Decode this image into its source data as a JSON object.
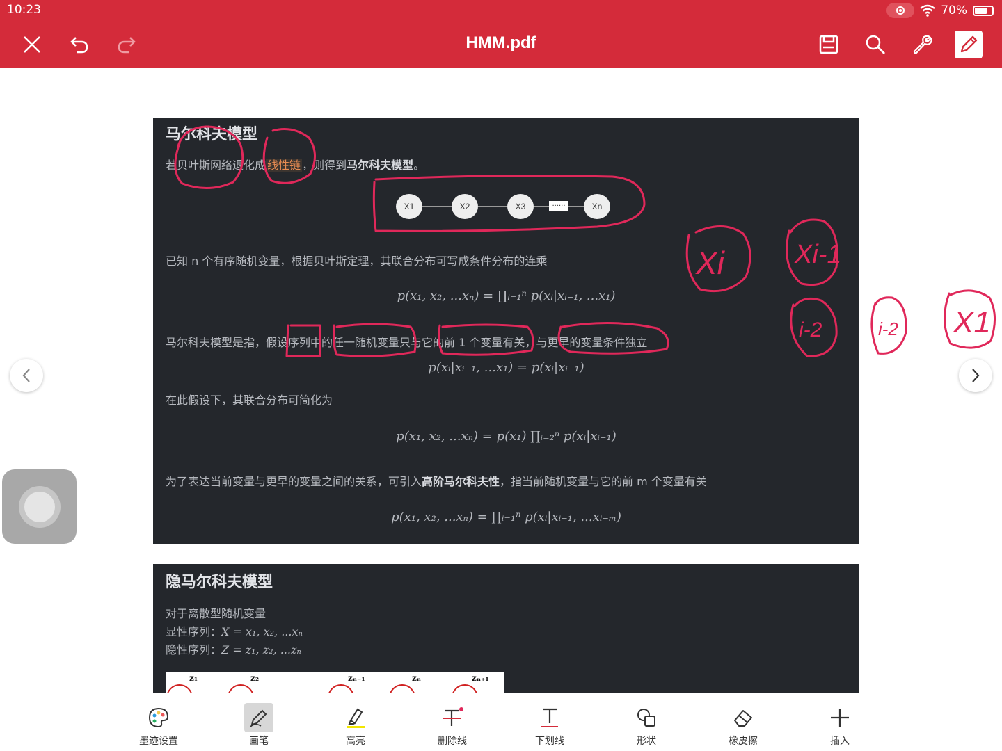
{
  "status_bar": {
    "time": "10:23",
    "battery": "70%",
    "battery_level": 0.7
  },
  "toolbar": {
    "title": "HMM.pdf"
  },
  "page1": {
    "heading": "马尔科夫模型",
    "intro": {
      "prefix": "若",
      "link_text": "贝叶斯网络",
      "middle": "退化成",
      "highlight": "线性链",
      "suffix_plain": "，则得到",
      "suffix_bold": "马尔科夫模型",
      "end": "。"
    },
    "chain_nodes": [
      "X1",
      "X2",
      "X3",
      "Xn"
    ],
    "chain_dots": "......",
    "known_text": "已知 n 个有序随机变量，根据贝叶斯定理，其联合分布可写成条件分布的连乘",
    "eq1": "p(x₁, x₂, ...xₙ) = ∏ᵢ₌₁ⁿ p(xᵢ|xᵢ₋₁, ...x₁)",
    "assume_text": "马尔科夫模型是指，假设序列中的任一随机变量只与它的前 1 个变量有关，与更早的变量条件独立",
    "eq2": "p(xᵢ|xᵢ₋₁, ...x₁) = p(xᵢ|xᵢ₋₁)",
    "simplify_text": "在此假设下，其联合分布可简化为",
    "eq3": "p(x₁, x₂, ...xₙ) = p(x₁) ∏ᵢ₌₂ⁿ p(xᵢ|xᵢ₋₁)",
    "higher": {
      "prefix": "为了表达当前变量与更早的变量之间的关系，可引入",
      "bold": "高阶马尔科夫性",
      "suffix": "，指当前随机变量与它的前 m 个变量有关"
    },
    "eq4": "p(x₁, x₂, ...xₙ) = ∏ᵢ₌₁ⁿ p(xᵢ|xᵢ₋₁, ...xᵢ₋ₘ)"
  },
  "page2": {
    "heading": "隐马尔科夫模型",
    "line1": "对于离散型随机变量",
    "line2_label": "显性序列：",
    "line2_math": "X = x₁, x₂, ...xₙ",
    "line3_label": "隐性序列：",
    "line3_math": "Z = z₁, z₂, ...zₙ",
    "figure_labels": [
      "z₁",
      "z₂",
      "zₙ₋₁",
      "zₙ",
      "zₙ₊₁"
    ]
  },
  "handwriting": [
    "Xi",
    "Xi-1",
    "i-2",
    "i-2",
    "X1"
  ],
  "bottom_tools": [
    {
      "label": "墨迹设置",
      "icon": "palette-icon"
    },
    {
      "label": "画笔",
      "icon": "pen-icon"
    },
    {
      "label": "高亮",
      "icon": "highlighter-icon"
    },
    {
      "label": "删除线",
      "icon": "strikethrough-icon"
    },
    {
      "label": "下划线",
      "icon": "underline-icon"
    },
    {
      "label": "形状",
      "icon": "shapes-icon"
    },
    {
      "label": "橡皮擦",
      "icon": "eraser-icon"
    },
    {
      "label": "插入",
      "icon": "plus-icon"
    }
  ],
  "colors": {
    "accent": "#d42b3a",
    "ink": "#e0285a",
    "page_bg": "#24272c"
  }
}
